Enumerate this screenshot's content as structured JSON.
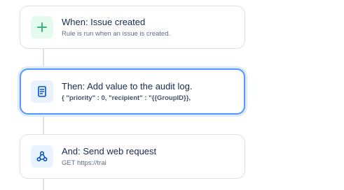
{
  "steps": [
    {
      "title": "When: Issue created",
      "subtitle": "Rule is run when an issue is created.",
      "icon": "plus-icon",
      "color": "#36b37e"
    },
    {
      "title": "Then: Add value to the audit log.",
      "subtitle": "{ \"priority\" : 0, \"recipient\" : \"{{GroupID}},",
      "icon": "document-icon",
      "color": "#0052cc"
    },
    {
      "title": "And: Send web request",
      "subtitle": "GET https://trai",
      "icon": "webhook-icon",
      "color": "#0052cc"
    }
  ]
}
